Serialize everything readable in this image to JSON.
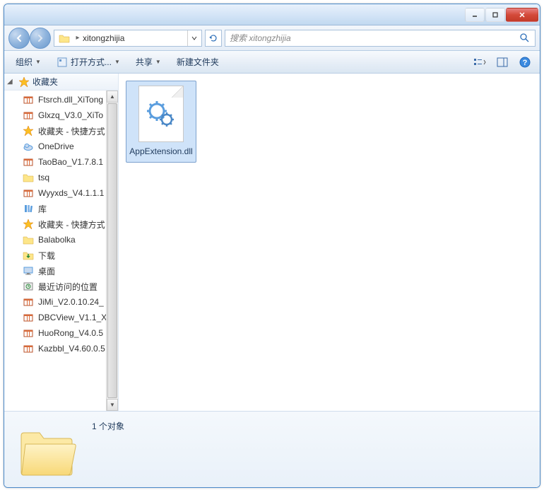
{
  "breadcrumb": {
    "path": "xitongzhijia"
  },
  "search": {
    "placeholder": "搜索 xitongzhijia"
  },
  "toolbar": {
    "organize": "组织",
    "open_with": "打开方式...",
    "share": "共享",
    "new_folder": "新建文件夹"
  },
  "sidebar": {
    "header": "收藏夹",
    "items": [
      {
        "label": "Ftsrch.dll_XiTong",
        "icon": "archive"
      },
      {
        "label": "Glxzq_V3.0_XiTo",
        "icon": "archive"
      },
      {
        "label": "收藏夹 - 快捷方式",
        "icon": "star"
      },
      {
        "label": "OneDrive",
        "icon": "onedrive"
      },
      {
        "label": "TaoBao_V1.7.8.1",
        "icon": "archive"
      },
      {
        "label": "tsq",
        "icon": "folder"
      },
      {
        "label": "Wyyxds_V4.1.1.1",
        "icon": "archive"
      },
      {
        "label": "库",
        "icon": "library"
      },
      {
        "label": "收藏夹 - 快捷方式",
        "icon": "star"
      },
      {
        "label": "Balabolka",
        "icon": "folder"
      },
      {
        "label": "下载",
        "icon": "folder-down"
      },
      {
        "label": "桌面",
        "icon": "desktop"
      },
      {
        "label": "最近访问的位置",
        "icon": "recent"
      },
      {
        "label": "JiMi_V2.0.10.24_",
        "icon": "archive"
      },
      {
        "label": "DBCView_V1.1_X",
        "icon": "archive"
      },
      {
        "label": "HuoRong_V4.0.5",
        "icon": "archive"
      },
      {
        "label": "Kazbbl_V4.60.0.5",
        "icon": "archive"
      }
    ]
  },
  "main": {
    "files": [
      {
        "name": "AppExtension.dll"
      }
    ]
  },
  "status": {
    "count_text": "1 个对象"
  }
}
